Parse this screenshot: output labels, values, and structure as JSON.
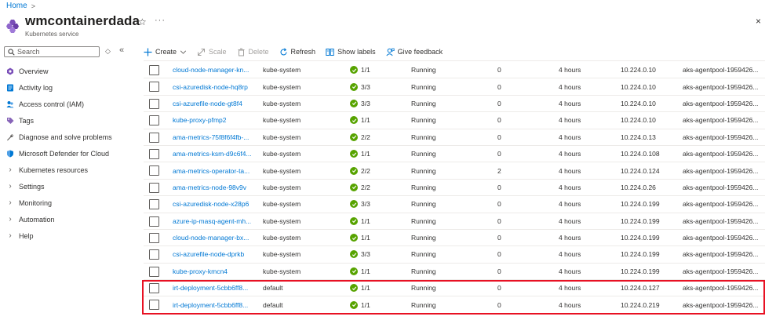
{
  "breadcrumb": {
    "home": "Home",
    "sep": ">"
  },
  "header": {
    "title": "wmcontainerdada",
    "subtitle": "Kubernetes service",
    "star": "☆",
    "more": "···",
    "close": "×"
  },
  "search": {
    "placeholder": "Search",
    "toggle": "◇",
    "collapse": "«"
  },
  "sidebar": {
    "items": [
      {
        "label": "Overview",
        "icon": "kubernetes-icon"
      },
      {
        "label": "Activity log",
        "icon": "activity-log-icon"
      },
      {
        "label": "Access control (IAM)",
        "icon": "iam-icon"
      },
      {
        "label": "Tags",
        "icon": "tag-icon"
      },
      {
        "label": "Diagnose and solve problems",
        "icon": "wrench-icon"
      },
      {
        "label": "Microsoft Defender for Cloud",
        "icon": "shield-icon"
      },
      {
        "label": "Kubernetes resources",
        "icon": "chevron-right-icon"
      },
      {
        "label": "Settings",
        "icon": "chevron-right-icon"
      },
      {
        "label": "Monitoring",
        "icon": "chevron-right-icon"
      },
      {
        "label": "Automation",
        "icon": "chevron-right-icon"
      },
      {
        "label": "Help",
        "icon": "chevron-right-icon"
      }
    ]
  },
  "toolbar": {
    "create": "Create",
    "scale": "Scale",
    "delete": "Delete",
    "refresh": "Refresh",
    "show_labels": "Show labels",
    "feedback": "Give feedback"
  },
  "colors": {
    "accent": "#0078d4",
    "success": "#57a300",
    "highlight": "#e81123"
  },
  "pods": [
    {
      "name": "cloud-node-manager-kn...",
      "namespace": "kube-system",
      "ready": "1/1",
      "status": "Running",
      "restarts": "0",
      "age": "4 hours",
      "ip": "10.224.0.10",
      "node": "aks-agentpool-1959426..."
    },
    {
      "name": "csi-azuredisk-node-hq8rp",
      "namespace": "kube-system",
      "ready": "3/3",
      "status": "Running",
      "restarts": "0",
      "age": "4 hours",
      "ip": "10.224.0.10",
      "node": "aks-agentpool-1959426..."
    },
    {
      "name": "csi-azurefile-node-gt8f4",
      "namespace": "kube-system",
      "ready": "3/3",
      "status": "Running",
      "restarts": "0",
      "age": "4 hours",
      "ip": "10.224.0.10",
      "node": "aks-agentpool-1959426..."
    },
    {
      "name": "kube-proxy-pfmp2",
      "namespace": "kube-system",
      "ready": "1/1",
      "status": "Running",
      "restarts": "0",
      "age": "4 hours",
      "ip": "10.224.0.10",
      "node": "aks-agentpool-1959426..."
    },
    {
      "name": "ama-metrics-75f8f6f4fb-...",
      "namespace": "kube-system",
      "ready": "2/2",
      "status": "Running",
      "restarts": "0",
      "age": "4 hours",
      "ip": "10.224.0.13",
      "node": "aks-agentpool-1959426..."
    },
    {
      "name": "ama-metrics-ksm-d9c6f4...",
      "namespace": "kube-system",
      "ready": "1/1",
      "status": "Running",
      "restarts": "0",
      "age": "4 hours",
      "ip": "10.224.0.108",
      "node": "aks-agentpool-1959426..."
    },
    {
      "name": "ama-metrics-operator-ta...",
      "namespace": "kube-system",
      "ready": "2/2",
      "status": "Running",
      "restarts": "2",
      "age": "4 hours",
      "ip": "10.224.0.124",
      "node": "aks-agentpool-1959426..."
    },
    {
      "name": "ama-metrics-node-98v9v",
      "namespace": "kube-system",
      "ready": "2/2",
      "status": "Running",
      "restarts": "0",
      "age": "4 hours",
      "ip": "10.224.0.26",
      "node": "aks-agentpool-1959426..."
    },
    {
      "name": "csi-azuredisk-node-x28p6",
      "namespace": "kube-system",
      "ready": "3/3",
      "status": "Running",
      "restarts": "0",
      "age": "4 hours",
      "ip": "10.224.0.199",
      "node": "aks-agentpool-1959426..."
    },
    {
      "name": "azure-ip-masq-agent-mh...",
      "namespace": "kube-system",
      "ready": "1/1",
      "status": "Running",
      "restarts": "0",
      "age": "4 hours",
      "ip": "10.224.0.199",
      "node": "aks-agentpool-1959426..."
    },
    {
      "name": "cloud-node-manager-bx...",
      "namespace": "kube-system",
      "ready": "1/1",
      "status": "Running",
      "restarts": "0",
      "age": "4 hours",
      "ip": "10.224.0.199",
      "node": "aks-agentpool-1959426..."
    },
    {
      "name": "csi-azurefile-node-dprkb",
      "namespace": "kube-system",
      "ready": "3/3",
      "status": "Running",
      "restarts": "0",
      "age": "4 hours",
      "ip": "10.224.0.199",
      "node": "aks-agentpool-1959426..."
    },
    {
      "name": "kube-proxy-kmcn4",
      "namespace": "kube-system",
      "ready": "1/1",
      "status": "Running",
      "restarts": "0",
      "age": "4 hours",
      "ip": "10.224.0.199",
      "node": "aks-agentpool-1959426..."
    },
    {
      "name": "irt-deployment-5cbb6ff8...",
      "namespace": "default",
      "ready": "1/1",
      "status": "Running",
      "restarts": "0",
      "age": "4 hours",
      "ip": "10.224.0.127",
      "node": "aks-agentpool-1959426..."
    },
    {
      "name": "irt-deployment-5cbb6ff8...",
      "namespace": "default",
      "ready": "1/1",
      "status": "Running",
      "restarts": "0",
      "age": "4 hours",
      "ip": "10.224.0.219",
      "node": "aks-agentpool-1959426..."
    }
  ]
}
